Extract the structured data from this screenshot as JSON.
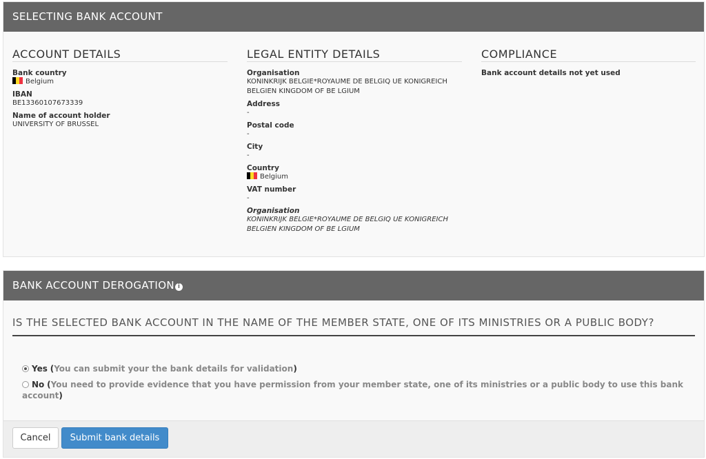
{
  "selecting_panel": {
    "title": "SELECTING BANK ACCOUNT",
    "account_details": {
      "heading": "ACCOUNT DETAILS",
      "bank_country_label": "Bank country",
      "bank_country_value": "Belgium",
      "iban_label": "IBAN",
      "iban_value": "BE13360107673339",
      "holder_label": "Name of account holder",
      "holder_value": "UNIVERSITY OF BRUSSEL"
    },
    "legal_entity": {
      "heading": "LEGAL ENTITY DETAILS",
      "organisation_label": "Organisation",
      "organisation_value": "KONINKRIJK BELGIE*ROYAUME DE BELGIQ UE KONIGREICH BELGIEN KINGDOM OF BE LGIUM",
      "address_label": "Address",
      "address_value": "-",
      "postal_label": "Postal code",
      "postal_value": "-",
      "city_label": "City",
      "city_value": "-",
      "country_label": "Country",
      "country_value": "Belgium",
      "vat_label": "VAT number",
      "vat_value": "-",
      "organisation2_label": "Organisation",
      "organisation2_value": "KONINKRIJK BELGIE*ROYAUME DE BELGIQ UE KONIGREICH BELGIEN KINGDOM OF BE LGIUM"
    },
    "compliance": {
      "heading": "COMPLIANCE",
      "status": "Bank account details not yet used"
    }
  },
  "derogation_panel": {
    "title": "BANK ACCOUNT DEROGATION",
    "question": "IS THE SELECTED BANK ACCOUNT IN THE NAME OF THE MEMBER STATE, ONE OF ITS MINISTRIES OR A PUBLIC BODY?",
    "options": [
      {
        "label": "Yes",
        "note": "You can submit your the bank details for validation",
        "selected": true
      },
      {
        "label": "No",
        "note": "You need to provide evidence that you have permission from your member state, one of its ministries or a public body to use this bank account",
        "selected": false
      }
    ],
    "cancel_label": "Cancel",
    "submit_label": "Submit bank details"
  },
  "colors": {
    "header_bg": "#666666",
    "primary_button": "#428bca",
    "belgium_flag": [
      "#000000",
      "#fdda24",
      "#ef3340"
    ]
  },
  "icons": [
    "flag-belgium-icon",
    "info-icon",
    "radio-icon"
  ]
}
